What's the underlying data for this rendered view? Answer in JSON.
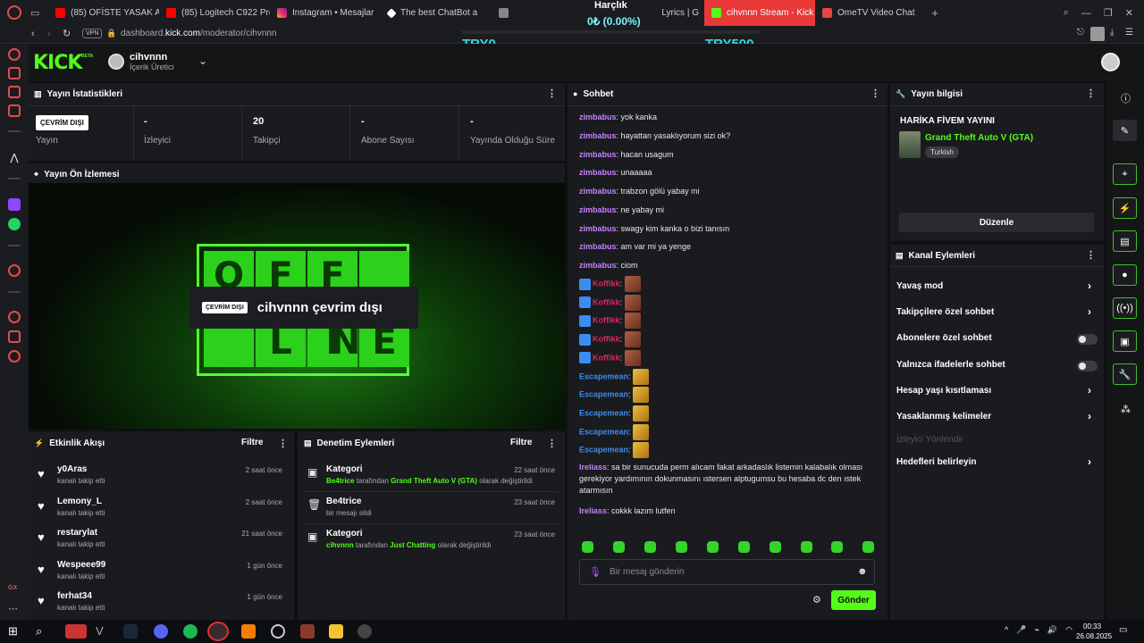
{
  "browser": {
    "tabs": [
      {
        "label": "(85) OFİSTE YASAK AŞK",
        "color": "#ff0000"
      },
      {
        "label": "(85) Logitech C922 Pro",
        "color": "#ff0000"
      },
      {
        "label": "Instagram • Mesajlar",
        "color": "#e1306c"
      },
      {
        "label": "The best ChatBot a",
        "color": "#ffffff"
      },
      {
        "label": "",
        "color": "#888888"
      },
      {
        "label": "",
        "color": "#888888"
      },
      {
        "label": "cihvnnn Stream - Kick Da",
        "color": "#53fc18",
        "active": true
      },
      {
        "label": "OmeTV Video Chat",
        "color": "#e84545"
      }
    ],
    "lyrics_tab": "Lyrics | G",
    "vpn": "VPN",
    "url_prefix": "dashboard.",
    "url_domain": "kick.com",
    "url_path": "/moderator/cihvnnn"
  },
  "overlay": {
    "title": "Harçlık",
    "percent_text": "0₺ (0.00%)",
    "progress": 0.0,
    "min_label": "TRY0",
    "max_label": "TRY500"
  },
  "header": {
    "logo": "KICK",
    "logo_beta": "BETA",
    "channel_name": "cihvnnn",
    "channel_role": "İçerik Üretici"
  },
  "stats": {
    "title": "Yayın İstatistikleri",
    "status_badge": "ÇEVRİM DIŞI",
    "cells": [
      {
        "value": "",
        "label": "Yayın"
      },
      {
        "value": "-",
        "label": "İzleyici"
      },
      {
        "value": "20",
        "label": "Takipçi"
      },
      {
        "value": "-",
        "label": "Abone Sayısı"
      },
      {
        "value": "-",
        "label": "Yayında Olduğu Süre"
      }
    ]
  },
  "preview": {
    "title": "Yayın Ön İzlemesi",
    "letters_top": [
      "O",
      "F",
      "F"
    ],
    "letters_bottom": [
      "L",
      "I",
      "N",
      "E"
    ],
    "caption_badge": "ÇEVRİM DIŞI",
    "caption_text": "cihvnnn çevrim dışı"
  },
  "activity": {
    "title": "Etkinlik Akışı",
    "filter": "Filtre",
    "items": [
      {
        "name": "y0Aras",
        "sub": "kanalı takip etti",
        "time": "2 saat önce"
      },
      {
        "name": "Lemony_L",
        "sub": "kanalı takip etti",
        "time": "2 saat önce"
      },
      {
        "name": "restarylat",
        "sub": "kanalı takip etti",
        "time": "21 saat önce"
      },
      {
        "name": "Wespeee99",
        "sub": "kanalı takip etti",
        "time": "1 gün önce"
      },
      {
        "name": "ferhat34",
        "sub": "kanalı takip etti",
        "time": "1 gün önce"
      }
    ]
  },
  "moderation": {
    "title": "Denetim Eylemleri",
    "filter": "Filtre",
    "items": [
      {
        "title": "Kategori",
        "time": "22 saat önce",
        "actor": "Be4trice",
        "mid": "tarafından",
        "target": "Grand Theft Auto V (GTA)",
        "tail": "olarak değiştirildi"
      },
      {
        "title": "Be4trice",
        "time": "23 saat önce",
        "actor": "",
        "mid": "bir mesajı sildi",
        "target": "",
        "tail": ""
      },
      {
        "title": "Kategori",
        "time": "23 saat önce",
        "actor": "cihvnnn",
        "mid": "tarafından",
        "target": "Just Chatting",
        "tail": "olarak değiştirildi"
      }
    ]
  },
  "chat": {
    "title": "Sohbet",
    "messages": [
      {
        "user": "zimbabus",
        "text": "yok kanka"
      },
      {
        "user": "zimbabus",
        "text": "hayattan yasaklıyorum sizi ok?"
      },
      {
        "user": "zimbabus",
        "text": "hacan usagum"
      },
      {
        "user": "zimbabus",
        "text": "unaaaaa"
      },
      {
        "user": "zimbabus",
        "text": "trabzon gölü yabay mi"
      },
      {
        "user": "zimbabus",
        "text": "ne yabay mi"
      },
      {
        "user": "zimbabus",
        "text": "swagy kim kanka o bizi tanısın"
      },
      {
        "user": "zimbabus",
        "text": "am var mi ya yenge"
      },
      {
        "user": "zimbabus",
        "text": "ciom"
      }
    ],
    "emote_users": [
      {
        "user": "Koffikk"
      },
      {
        "user": "Koffikk"
      },
      {
        "user": "Koffikk"
      },
      {
        "user": "Koffikk"
      },
      {
        "user": "Koffikk"
      },
      {
        "user": "Escapemean"
      },
      {
        "user": "Escapemean"
      },
      {
        "user": "Escapemean"
      },
      {
        "user": "Escapemean"
      },
      {
        "user": "Escapemean"
      }
    ],
    "long_msg": {
      "user": "Ireliass",
      "text": "sa bir sunucuda perm alıcam fakat arkadaslık listemin kalabalık olması gerekiyor yardımının dokunmasını ıstersen alptugumsu bu hesaba dc den ıstek atarmısın"
    },
    "last_msg": {
      "user": "Ireliass",
      "text": "cokkk lazım lutfen"
    },
    "input_placeholder": "Bir mesaj gönderin",
    "send_label": "Gönder"
  },
  "stream_info": {
    "title": "Yayın bilgisi",
    "stream_title": "HARİKA FİVEM YAYINI",
    "category": "Grand Theft Auto V (GTA)",
    "language": "Turkish",
    "edit_label": "Düzenle"
  },
  "channel_actions": {
    "title": "Kanal Eylemleri",
    "items": [
      {
        "label": "Yavaş mod",
        "control": "chevron"
      },
      {
        "label": "Takipçilere özel sohbet",
        "control": "chevron"
      },
      {
        "label": "Abonelere özel sohbet",
        "control": "toggle",
        "on": false
      },
      {
        "label": "Yalnızca ifadelerle sohbet",
        "control": "toggle",
        "on": false
      },
      {
        "label": "Hesap yaşı kısıtlaması",
        "control": "chevron"
      },
      {
        "label": "Yasaklanmış kelimeler",
        "control": "chevron"
      },
      {
        "label": "İzleyici Yönlendir",
        "control": "none",
        "disabled": true
      },
      {
        "label": "Hedefleri belirleyin",
        "control": "chevron"
      }
    ]
  },
  "taskbar": {
    "time": "00:33",
    "date": "26.08.2025"
  },
  "colors": {
    "kick_green": "#53fc18",
    "username_purple": "#c680ff",
    "username_red": "#e2245d",
    "username_blue": "#3b8df0",
    "overlay_cyan": "#34d7e0"
  }
}
